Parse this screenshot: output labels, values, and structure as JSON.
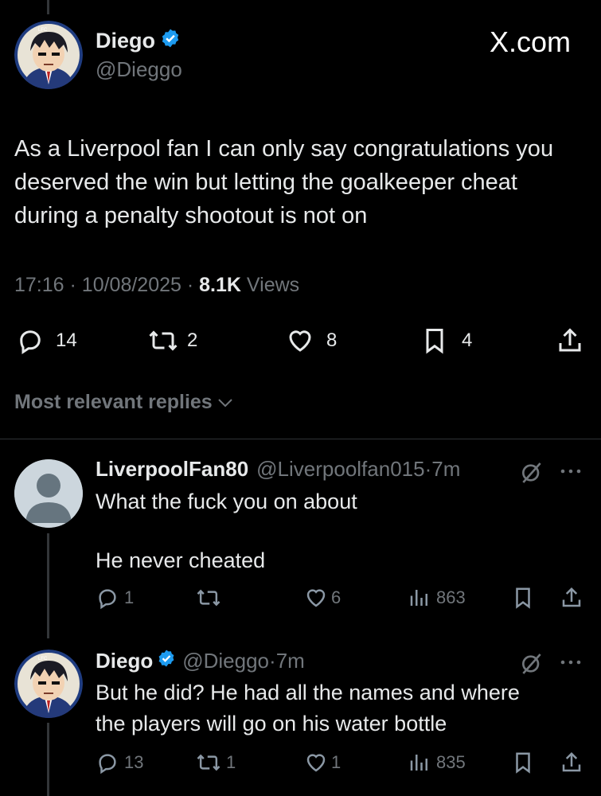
{
  "main_tweet": {
    "author_name": "Diego",
    "author_handle": "@Dieggo",
    "watermark": "X.com",
    "text": "As a Liverpool fan I can only say congratulations you deserved the win but letting the goalkeeper cheat during a penalty shootout is not on",
    "time": "17:16",
    "date": "10/08/2025",
    "views_count": "8.1K",
    "views_label": "Views",
    "replies": "14",
    "reposts": "2",
    "likes": "8",
    "bookmarks": "4"
  },
  "sort": {
    "label": "Most relevant replies"
  },
  "replies": [
    {
      "author_name": "LiverpoolFan80",
      "author_handle": "@Liverpoolfan015",
      "time": "7m",
      "line1": "What the fuck you on about",
      "line2": "He never cheated",
      "replies": "1",
      "reposts": "",
      "likes": "6",
      "views": "863"
    },
    {
      "author_name": "Diego",
      "author_handle": "@Dieggo",
      "time": "7m",
      "line1": "But he did? He had all the names and where",
      "line2": "the players will go on his water bottle",
      "replies": "13",
      "reposts": "1",
      "likes": "1",
      "views": "835"
    }
  ],
  "colors": {
    "background": "#000000",
    "text": "#e7e9ea",
    "muted": "#71767b",
    "verified": "#1d9bf0",
    "divider": "#2f3336"
  }
}
